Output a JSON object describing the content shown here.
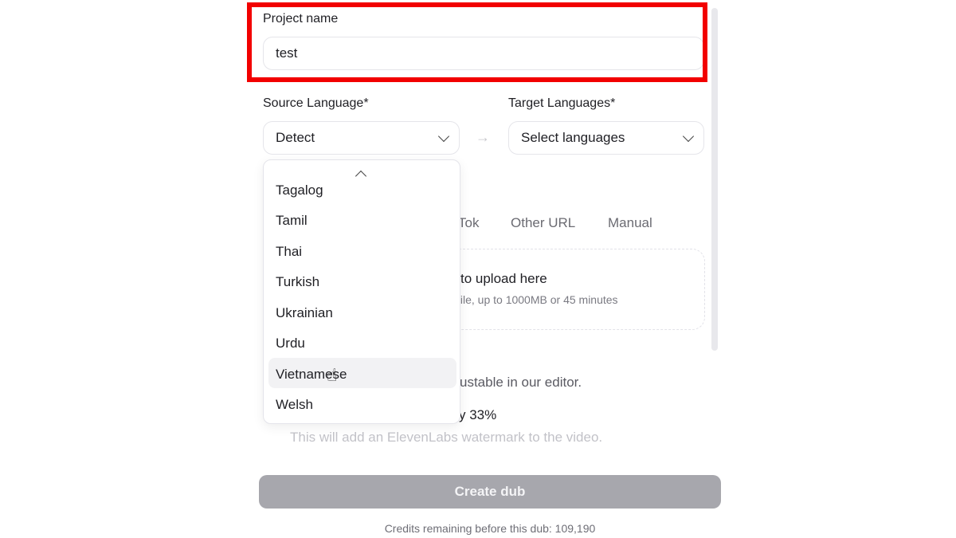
{
  "project": {
    "label": "Project name",
    "value": "test"
  },
  "source": {
    "label": "Source Language*",
    "value": "Detect"
  },
  "target": {
    "label": "Target Languages*",
    "placeholder": "Select languages"
  },
  "tabs": [
    "Tok",
    "Other URL",
    "Manual"
  ],
  "upload": {
    "title": "to upload here",
    "subtitle": "file, up to 1000MB or 45 minutes"
  },
  "options_text": {
    "editor_note": "ustable in our editor.",
    "percent_note": "y 33%",
    "watermark_note": "This will add an ElevenLabs watermark to the video."
  },
  "dropdown": {
    "items": [
      "Tagalog",
      "Tamil",
      "Thai",
      "Turkish",
      "Ukrainian",
      "Urdu",
      "Vietnamese",
      "Welsh"
    ],
    "hovered": "Vietnamese"
  },
  "action": {
    "create_label": "Create dub"
  },
  "credits": "Credits remaining before this dub: 109,190",
  "colors": {
    "highlight": "#f20000",
    "button_disabled": "#a7a7ad"
  }
}
